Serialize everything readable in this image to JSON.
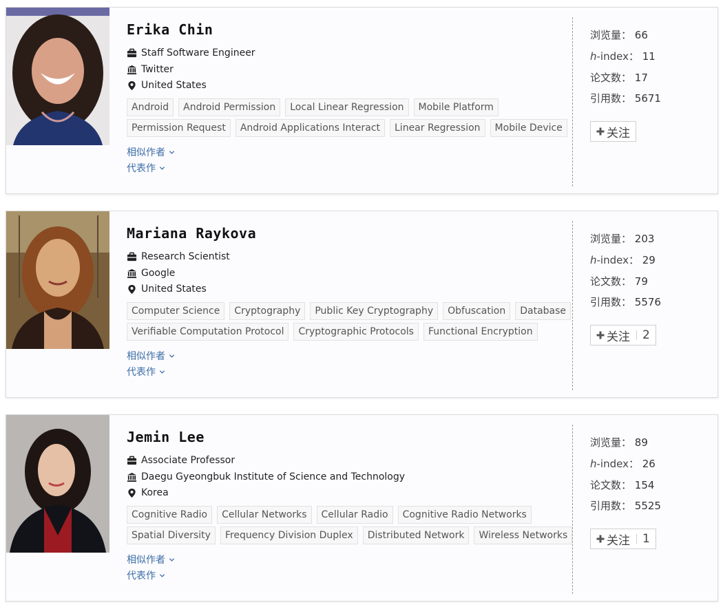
{
  "labels": {
    "views": "浏览量：",
    "h_prefix": "h",
    "h_suffix": "-index：",
    "papers": "论文数：",
    "citations": "引用数：",
    "follow": "关注",
    "similar_authors": "相似作者",
    "representative_works": "代表作"
  },
  "authors": [
    {
      "name": "Erika Chin",
      "position": "Staff Software Engineer",
      "org": "Twitter",
      "location": "United States",
      "tags_row1": [
        "Android",
        "Android Permission",
        "Local Linear Regression",
        "Mobile Platform"
      ],
      "tags_row2": [
        "Permission Request",
        "Android Applications Interact",
        "Linear Regression",
        "Mobile Device"
      ],
      "views": "66",
      "h_index": "11",
      "papers": "17",
      "citations": "5671",
      "follow_count": ""
    },
    {
      "name": "Mariana Raykova",
      "position": "Research Scientist",
      "org": "Google",
      "location": "United States",
      "tags_row1": [
        "Computer Science",
        "Cryptography",
        "Public Key Cryptography",
        "Obfuscation",
        "Database"
      ],
      "tags_row2": [
        "Verifiable Computation Protocol",
        "Cryptographic Protocols",
        "Functional Encryption"
      ],
      "views": "203",
      "h_index": "29",
      "papers": "79",
      "citations": "5576",
      "follow_count": "2"
    },
    {
      "name": "Jemin Lee",
      "position": "Associate Professor",
      "org": "Daegu Gyeongbuk Institute of Science and Technology",
      "location": "Korea",
      "tags_row1": [
        "Cognitive Radio",
        "Cellular Networks",
        "Cellular Radio",
        "Cognitive Radio Networks"
      ],
      "tags_row2": [
        "Spatial Diversity",
        "Frequency Division Duplex",
        "Distributed Network",
        "Wireless Networks"
      ],
      "views": "89",
      "h_index": "26",
      "papers": "154",
      "citations": "5525",
      "follow_count": "1"
    }
  ],
  "colors": {
    "link": "#3b6ea5",
    "tag_bg": "#f7f7f7",
    "tag_border": "#e2e2e2",
    "card_bg": "#fcfbfe"
  },
  "icons": {
    "position": "briefcase-icon",
    "org": "institution-icon",
    "location": "map-pin-icon",
    "follow": "plus-icon",
    "expand": "chevron-down-icon"
  }
}
